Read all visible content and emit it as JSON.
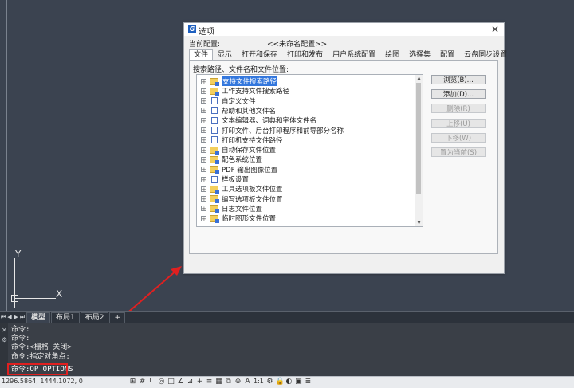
{
  "dialog": {
    "title": "选项",
    "app_icon": "G",
    "current_profile_label": "当前配置:",
    "current_profile_value": "<<未命名配置>>",
    "tabs": [
      {
        "label": "文件",
        "active": true
      },
      {
        "label": "显示"
      },
      {
        "label": "打开和保存"
      },
      {
        "label": "打印和发布"
      },
      {
        "label": "用户系统配置"
      },
      {
        "label": "绘图"
      },
      {
        "label": "选择集"
      },
      {
        "label": "配置"
      },
      {
        "label": "云盘同步设置"
      }
    ],
    "search_path_label": "搜索路径、文件名和文件位置:",
    "tree_items": [
      {
        "label": "支持文件搜索路径",
        "icon": "folder",
        "selected": true
      },
      {
        "label": "工作支持文件搜索路径",
        "icon": "folder"
      },
      {
        "label": "自定义文件",
        "icon": "document"
      },
      {
        "label": "帮助和其他文件名",
        "icon": "document"
      },
      {
        "label": "文本编辑器、词典和字体文件名",
        "icon": "document"
      },
      {
        "label": "打印文件、后台打印程序和前导部分名称",
        "icon": "document"
      },
      {
        "label": "打印机支持文件路径",
        "icon": "document"
      },
      {
        "label": "自动保存文件位置",
        "icon": "folder"
      },
      {
        "label": "配色系统位置",
        "icon": "folder"
      },
      {
        "label": "PDF 输出图像位置",
        "icon": "folder"
      },
      {
        "label": "样板设置",
        "icon": "document"
      },
      {
        "label": "工具选项板文件位置",
        "icon": "folder"
      },
      {
        "label": "编写选项板文件位置",
        "icon": "folder"
      },
      {
        "label": "日志文件位置",
        "icon": "folder"
      },
      {
        "label": "临时图形文件位置",
        "icon": "folder"
      }
    ],
    "buttons": [
      {
        "label": "浏览(B)...",
        "enabled": true
      },
      {
        "label": "添加(D)...",
        "enabled": true
      },
      {
        "label": "删除(R)",
        "enabled": false
      },
      {
        "label": "上移(U)",
        "enabled": false
      },
      {
        "label": "下移(W)",
        "enabled": false
      },
      {
        "label": "置为当前(S)",
        "enabled": false
      }
    ]
  },
  "layout_tabs": {
    "model": "模型",
    "layout1": "布局1",
    "layout2": "布局2"
  },
  "ucs": {
    "x": "X",
    "y": "Y"
  },
  "command_history": [
    "命令:",
    "命令:",
    "命令:<栅格 关闭>",
    "命令:指定对角点:"
  ],
  "command_input": "命令:OP OPTIONS",
  "status": {
    "coordinates": "1296.5864, 1444.1072, 0",
    "scale": "1:1"
  },
  "colors": {
    "canvas_bg": "#3b4350",
    "annotation_red": "#e02020",
    "selection_blue": "#3377dd"
  }
}
